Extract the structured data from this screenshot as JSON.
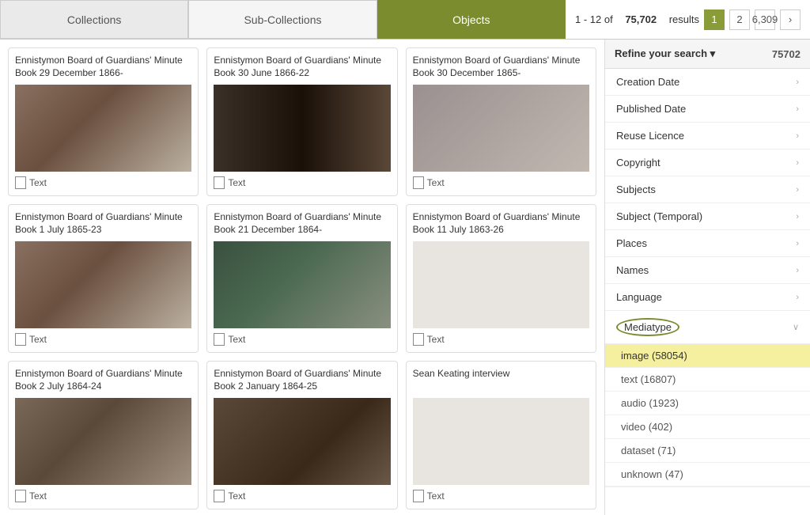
{
  "tabs": [
    {
      "id": "collections",
      "label": "Collections",
      "active": false
    },
    {
      "id": "sub-collections",
      "label": "Sub-Collections",
      "active": false
    },
    {
      "id": "objects",
      "label": "Objects",
      "active": true
    }
  ],
  "pagination": {
    "results_prefix": "1 - 12 of",
    "total": "75,702",
    "results_suffix": "results",
    "current_page": "1",
    "page2": "2",
    "last_page": "6,309",
    "next_arrow": "›"
  },
  "items": [
    {
      "id": 1,
      "title": "Ennistymon Board of Guardians' Minute Book 29 December 1866-",
      "type": "Text",
      "thumb": "thumb-1"
    },
    {
      "id": 2,
      "title": "Ennistymon Board of Guardians' Minute Book 30 June 1866-22",
      "type": "Text",
      "thumb": "thumb-2"
    },
    {
      "id": 3,
      "title": "Ennistymon Board of Guardians' Minute Book 30 December 1865-",
      "type": "Text",
      "thumb": "thumb-3"
    },
    {
      "id": 4,
      "title": "Ennistymon Board of Guardians' Minute Book 1 July 1865-23",
      "type": "Text",
      "thumb": "thumb-4"
    },
    {
      "id": 5,
      "title": "Ennistymon Board of Guardians' Minute Book 21 December 1864-",
      "type": "Text",
      "thumb": "thumb-5"
    },
    {
      "id": 6,
      "title": "Ennistymon Board of Guardians' Minute Book 11 July 1863-26",
      "type": "Text",
      "thumb": "thumb-empty"
    },
    {
      "id": 7,
      "title": "Ennistymon Board of Guardians' Minute Book 2 July 1864-24",
      "type": "Text",
      "thumb": "thumb-7"
    },
    {
      "id": 8,
      "title": "Ennistymon Board of Guardians' Minute Book 2 January 1864-25",
      "type": "Text",
      "thumb": "thumb-8"
    },
    {
      "id": 9,
      "title": "Sean Keating interview",
      "type": "Text",
      "thumb": "thumb-empty"
    }
  ],
  "sidebar": {
    "refine_label": "Refine your search ▾",
    "count": "75702",
    "filters": [
      {
        "id": "creation-date",
        "label": "Creation Date"
      },
      {
        "id": "published-date",
        "label": "Published Date"
      },
      {
        "id": "reuse-licence",
        "label": "Reuse Licence"
      },
      {
        "id": "copyright",
        "label": "Copyright"
      },
      {
        "id": "subjects",
        "label": "Subjects"
      },
      {
        "id": "subject-temporal",
        "label": "Subject (Temporal)"
      },
      {
        "id": "places",
        "label": "Places"
      },
      {
        "id": "names",
        "label": "Names"
      },
      {
        "id": "language",
        "label": "Language"
      }
    ],
    "mediatype": {
      "label": "Mediatype",
      "chevron": "∨",
      "options": [
        {
          "id": "image",
          "label": "image (58054)",
          "highlighted": true
        },
        {
          "id": "text",
          "label": "text (16807)",
          "highlighted": false
        },
        {
          "id": "audio",
          "label": "audio (1923)",
          "highlighted": false
        },
        {
          "id": "video",
          "label": "video (402)",
          "highlighted": false
        },
        {
          "id": "dataset",
          "label": "dataset (71)",
          "highlighted": false
        },
        {
          "id": "unknown",
          "label": "unknown (47)",
          "highlighted": false
        }
      ]
    }
  }
}
